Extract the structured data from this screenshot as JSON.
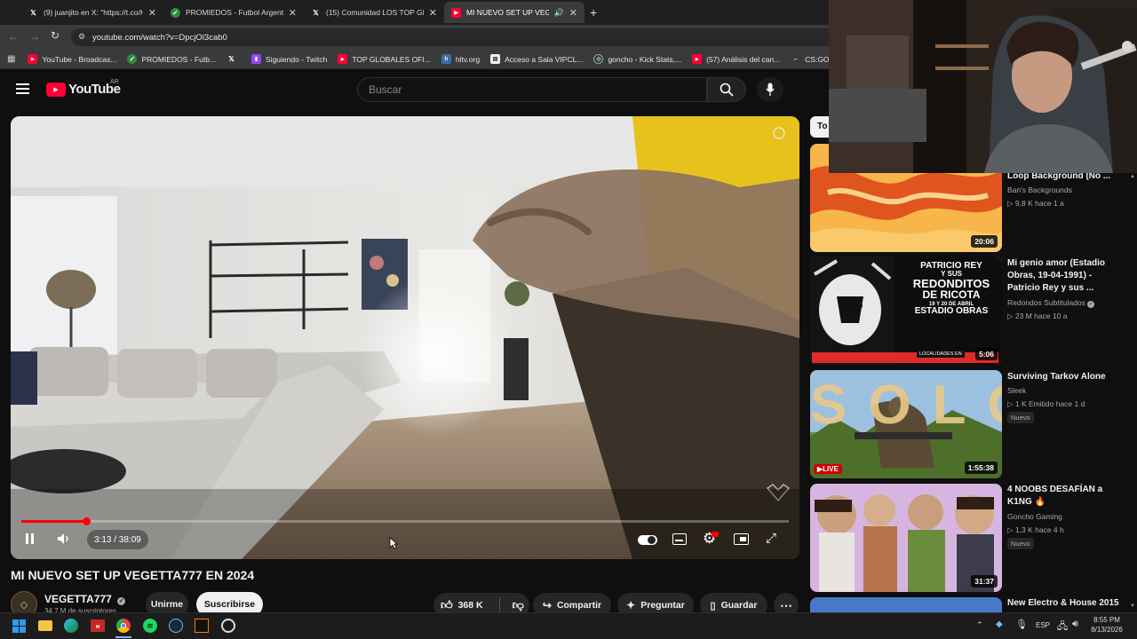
{
  "browser": {
    "tabs": [
      {
        "label": "(9) juanjito en X: \"https://t.co/H",
        "icon": "x-logo-icon",
        "active": false
      },
      {
        "label": "PROMIEDOS - Futbol Argentino",
        "icon": "promiedos-icon",
        "active": false
      },
      {
        "label": "(15) Comunidad LOS TOP GLOB",
        "icon": "x-logo-icon",
        "active": false
      },
      {
        "label": "MI NUEVO SET UP VEGETTA",
        "icon": "youtube-icon",
        "active": true
      }
    ],
    "new_tab": "+",
    "url": "youtube.com/watch?v=DpcjOl3cab0",
    "bookmarks": [
      {
        "label": "YouTube - Broadcas...",
        "icon": "youtube-icon"
      },
      {
        "label": "PROMIEDOS - Futb...",
        "icon": "promiedos-icon"
      },
      {
        "label": "",
        "icon": "x-logo-icon"
      },
      {
        "label": "Siguiendo - Twitch",
        "icon": "twitch-icon"
      },
      {
        "label": "TOP GLOBALES OFI...",
        "icon": "youtube-icon"
      },
      {
        "label": "hltv.org",
        "icon": "hltv-icon"
      },
      {
        "label": "Acceso a Sala VIPCL...",
        "icon": "page-icon"
      },
      {
        "label": "goncho - Kick Stats,...",
        "icon": "globe-icon"
      },
      {
        "label": "(57) Análisis del can...",
        "icon": "youtube-icon"
      },
      {
        "label": "CS:GO Major Match...",
        "icon": "csgo-icon"
      }
    ]
  },
  "youtube": {
    "logo_text": "YouTube",
    "region": "AR",
    "search_placeholder": "Buscar",
    "video": {
      "title": "MI NUEVO SET UP VEGETTA777 EN 2024",
      "time": "3:13 / 38:09",
      "progress": 0.084,
      "buffered": 0.09
    },
    "channel": {
      "name": "VEGETTA777",
      "subs": "34,7 M de suscriptores"
    },
    "actions": {
      "join": "Unirme",
      "subscribe": "Suscribirse",
      "likes": "368 K",
      "share": "Compartir",
      "ask": "Preguntar",
      "save": "Guardar"
    },
    "chip_partial": "To",
    "sidebar": [
      {
        "title": "Loop Background (No ...",
        "channel": "Ban's Backgrounds",
        "meta": "9,8 K  hace 1 a",
        "duration": "20:06",
        "live": false,
        "badge": ""
      },
      {
        "title": "Mi genio amor (Estadio Obras, 19-04-1991) - Patricio Rey y sus ...",
        "channel": "Redondos Subtitulados",
        "meta": "23 M  hace 10 a",
        "duration": "5:06",
        "live": false,
        "badge": "",
        "thumb_text": {
          "l1": "PATRICIO REY",
          "l2": "Y SUS",
          "l3": "REDONDITOS",
          "l4": "DE RICOTA",
          "l5": "19 Y 20 DE ABRIL",
          "l6": "ESTADIO OBRAS",
          "l7": "LOCALIDADES EN"
        }
      },
      {
        "title": "Surviving Tarkov Alone",
        "channel": "Sleek",
        "meta": "1 K  Emitido hace 1 d",
        "duration": "1:55:38",
        "live": true,
        "live_label": "LIVE",
        "badge": "Nuevo",
        "thumb_text": "SOLO"
      },
      {
        "title": "4 NOOBS DESAFÍAN a K1NG 🔥",
        "channel": "Goncho Gaming",
        "meta": "1,3 K  hace 4 h",
        "duration": "31:37",
        "live": false,
        "badge": "Nuevo"
      },
      {
        "title": "New Electro & House 2015",
        "channel": "",
        "meta": "",
        "duration": "",
        "live": false,
        "badge": ""
      }
    ]
  },
  "taskbar": {
    "lang": "ESP",
    "time": "8:55 PM",
    "date": "8/13/2026"
  },
  "colors": {
    "progress_red": "#ff0000",
    "subscribe_bg": "#f1f1f1",
    "yt_red": "#ff0033"
  }
}
